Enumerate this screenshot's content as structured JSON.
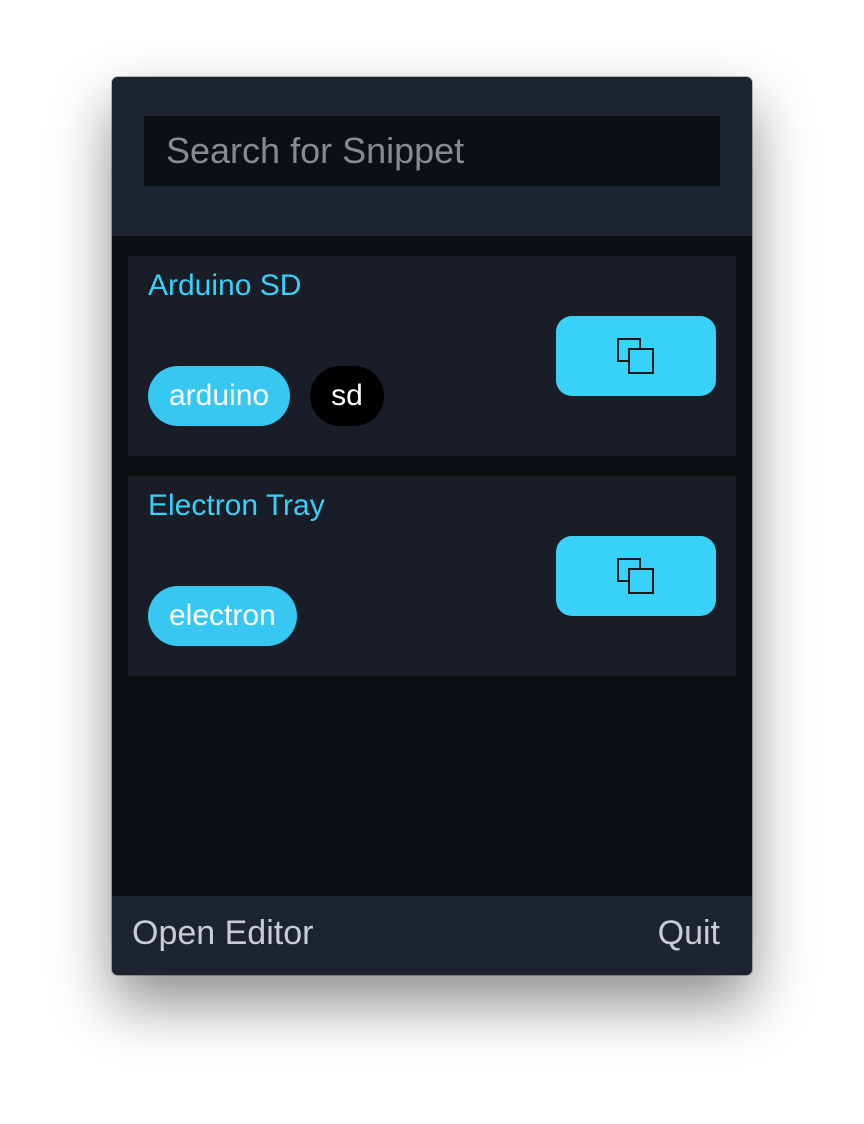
{
  "search": {
    "placeholder": "Search for Snippet",
    "value": ""
  },
  "snippets": [
    {
      "title": "Arduino SD",
      "tags": [
        {
          "label": "arduino",
          "color": "#37c8f1"
        },
        {
          "label": "sd",
          "color": "#000000"
        }
      ],
      "action_icon": "copy-icon"
    },
    {
      "title": "Electron Tray",
      "tags": [
        {
          "label": "electron",
          "color": "#37c8f1"
        }
      ],
      "action_icon": "copy-icon"
    }
  ],
  "footer": {
    "open_editor_label": "Open Editor",
    "quit_label": "Quit"
  },
  "colors": {
    "accent": "#38d2f8",
    "title_text": "#3ad0f6",
    "header_bg": "#1e2331",
    "card_bg": "#181d27",
    "body_bg": "#0c1012"
  }
}
